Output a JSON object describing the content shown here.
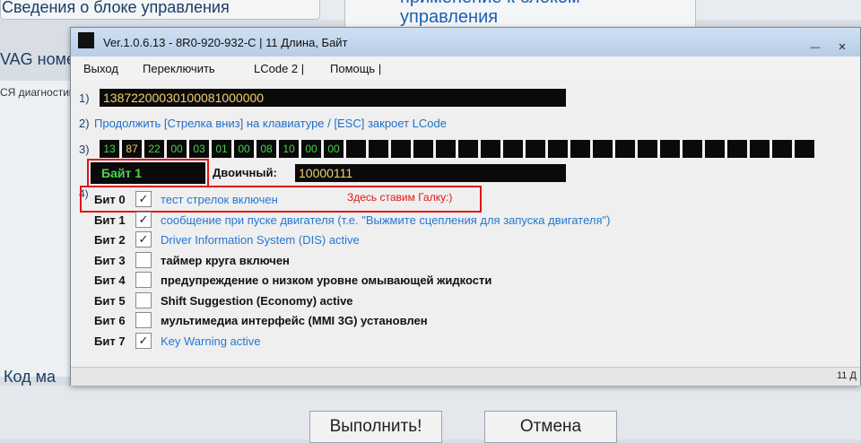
{
  "background": {
    "heading_top": "применение к блоком",
    "heading": "управления",
    "tab_item": "Сведения о блоке управления",
    "side_vag": "VAG номер",
    "side_diag": "СЯ диагностика",
    "code_label": "Код ма",
    "execute_button": "Выполнить!",
    "cancel_button": "Отмена"
  },
  "window": {
    "title": "Ver.1.0.6.13 -    8R0-920-932-C | 11 Длина, Байт",
    "minimize": "—",
    "close": "✕"
  },
  "menu": [
    "Выход",
    "Переключить",
    "LCode 2 |",
    "Помощь |"
  ],
  "row1": {
    "num": "1)",
    "value": "13872200030100081000000"
  },
  "row2": {
    "num": "2)",
    "text": "Продолжить [Стрелка вниз] на клавиатуре / [ESC] закроет LCode"
  },
  "row3": {
    "num": "3)",
    "bytes": [
      "13",
      "87",
      "22",
      "00",
      "03",
      "01",
      "00",
      "08",
      "10",
      "00",
      "00",
      "",
      "",
      "",
      "",
      "",
      "",
      "",
      "",
      "",
      "",
      "",
      "",
      "",
      "",
      "",
      "",
      "",
      "",
      "",
      "",
      ""
    ],
    "selected_index": 1
  },
  "byte": {
    "label": "Байт 1",
    "binary_label": "Двоичный:",
    "binary_value": "10000111"
  },
  "row4_num": "4)",
  "annotation": "Здесь ставим Галку:)",
  "bits": [
    {
      "label": "Бит 0",
      "checked": true,
      "text": "тест стрелок включен"
    },
    {
      "label": "Бит 1",
      "checked": true,
      "text": "сообщение при пуске двигателя (т.е. \"Выжмите сцепления для запуска двигателя\")"
    },
    {
      "label": "Бит 2",
      "checked": true,
      "text": "Driver Information System (DIS) active"
    },
    {
      "label": "Бит 3",
      "checked": false,
      "text": "таймер круга включен"
    },
    {
      "label": "Бит 4",
      "checked": false,
      "text": "предупреждение о низком уровне омывающей жидкости"
    },
    {
      "label": "Бит 5",
      "checked": false,
      "text": "Shift Suggestion (Economy) active"
    },
    {
      "label": "Бит 6",
      "checked": false,
      "text": "мультимедиа интерфейс (MMI 3G) установлен"
    },
    {
      "label": "Бит 7",
      "checked": true,
      "text": "Key Warning active"
    }
  ],
  "status": "11 Д",
  "colors": {
    "annotation_red": "#e11414",
    "active_bit_blue": "#2377d4",
    "byte_green": "#4fd24f",
    "value_yellow": "#f3d26a"
  }
}
